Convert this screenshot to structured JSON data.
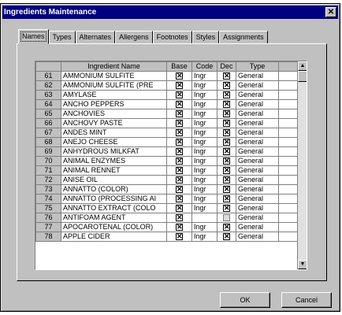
{
  "window": {
    "title": "Ingredients Maintenance",
    "close_glyph": "✕"
  },
  "tabs": [
    {
      "label": "Names",
      "active": true
    },
    {
      "label": "Types"
    },
    {
      "label": "Alternates"
    },
    {
      "label": "Allergens"
    },
    {
      "label": "Footnotes"
    },
    {
      "label": "Styles"
    },
    {
      "label": "Assignments"
    }
  ],
  "grid": {
    "columns": [
      "Ingredient Name",
      "Base",
      "Code",
      "Dec",
      "Type"
    ],
    "rows": [
      {
        "num": "61",
        "name": "AMMONIUM SULFITE",
        "base": true,
        "code": "Ingr",
        "dec": true,
        "type": "General"
      },
      {
        "num": "62",
        "name": "AMMONIUM SULFITE (PRE",
        "base": true,
        "code": "Ingr",
        "dec": true,
        "type": "General"
      },
      {
        "num": "63",
        "name": "AMYLASE",
        "base": true,
        "code": "Ingr",
        "dec": true,
        "type": "General"
      },
      {
        "num": "64",
        "name": "ANCHO PEPPERS",
        "base": true,
        "code": "Ingr",
        "dec": true,
        "type": "General"
      },
      {
        "num": "65",
        "name": "ANCHOVIES",
        "base": true,
        "code": "Ingr",
        "dec": true,
        "type": "General"
      },
      {
        "num": "66",
        "name": "ANCHOVY PASTE",
        "base": true,
        "code": "Ingr",
        "dec": true,
        "type": "General"
      },
      {
        "num": "67",
        "name": "ANDES MINT",
        "base": true,
        "code": "Ingr",
        "dec": true,
        "type": "General"
      },
      {
        "num": "68",
        "name": "ANEJO CHEESE",
        "base": true,
        "code": "Ingr",
        "dec": true,
        "type": "General"
      },
      {
        "num": "69",
        "name": "ANHYDROUS MILKFAT",
        "base": true,
        "code": "Ingr",
        "dec": true,
        "type": "General"
      },
      {
        "num": "70",
        "name": "ANIMAL ENZYMES",
        "base": true,
        "code": "Ingr",
        "dec": true,
        "type": "General"
      },
      {
        "num": "71",
        "name": "ANIMAL RENNET",
        "base": true,
        "code": "Ingr",
        "dec": true,
        "type": "General"
      },
      {
        "num": "72",
        "name": "ANISE OIL",
        "base": true,
        "code": "Ingr",
        "dec": true,
        "type": "General"
      },
      {
        "num": "73",
        "name": "ANNATTO (COLOR)",
        "base": true,
        "code": "Ingr",
        "dec": true,
        "type": "General"
      },
      {
        "num": "74",
        "name": "ANNATTO (PROCESSING AI",
        "base": true,
        "code": "Ingr",
        "dec": true,
        "type": "General"
      },
      {
        "num": "75",
        "name": "ANNATTO EXTRACT (COLO",
        "base": true,
        "code": "Ingr",
        "dec": true,
        "type": "General"
      },
      {
        "num": "76",
        "name": "ANTIFOAM AGENT",
        "base": true,
        "code": "",
        "dec": false,
        "type": "General"
      },
      {
        "num": "77",
        "name": "APOCAROTENAL (COLOR)",
        "base": true,
        "code": "Ingr",
        "dec": true,
        "type": "General"
      },
      {
        "num": "78",
        "name": "APPLE CIDER",
        "base": true,
        "code": "Ingr",
        "dec": true,
        "type": "General"
      }
    ]
  },
  "buttons": {
    "ok": "OK",
    "cancel": "Cancel"
  }
}
